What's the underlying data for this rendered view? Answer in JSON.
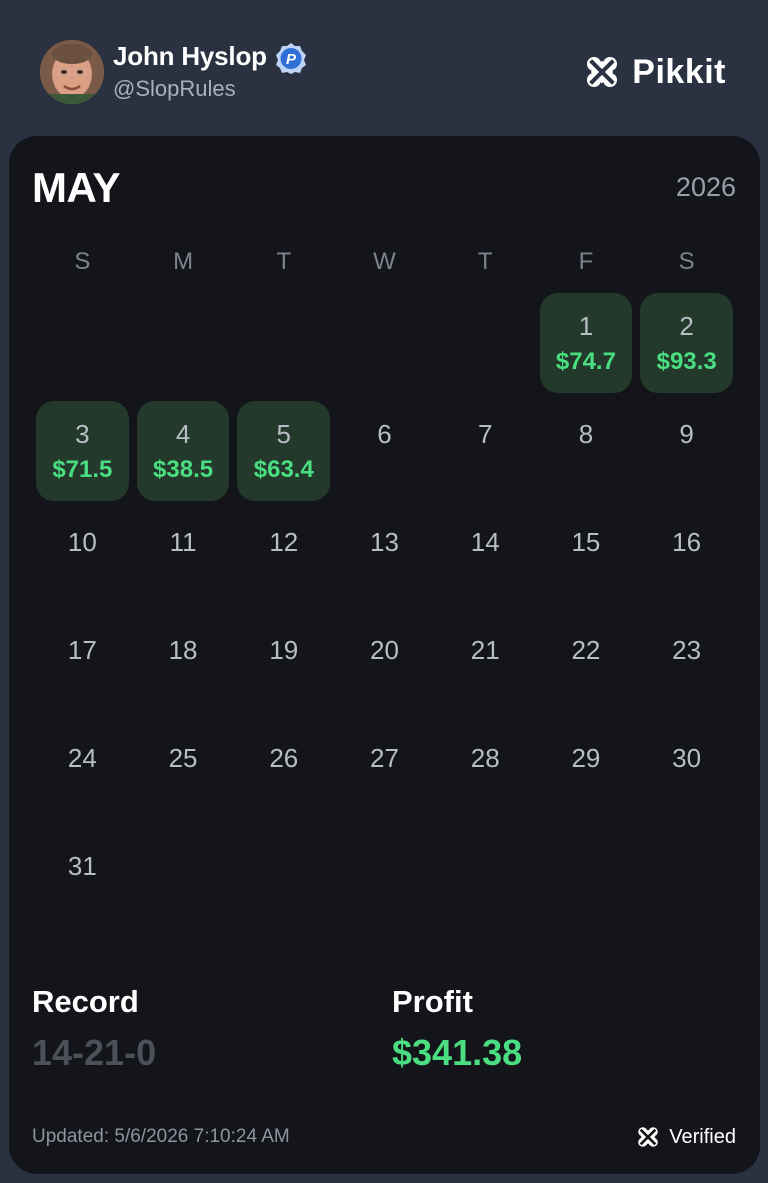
{
  "header": {
    "user_name": "John Hyslop",
    "user_handle": "@SlopRules",
    "badge_letter": "P",
    "brand_name": "Pikkit"
  },
  "calendar": {
    "month": "MAY",
    "year": "2026",
    "weekdays": [
      "S",
      "M",
      "T",
      "W",
      "T",
      "F",
      "S"
    ],
    "leading_blanks": 5,
    "days": [
      {
        "num": "1",
        "value": "$74.7"
      },
      {
        "num": "2",
        "value": "$93.3"
      },
      {
        "num": "3",
        "value": "$71.5"
      },
      {
        "num": "4",
        "value": "$38.5"
      },
      {
        "num": "5",
        "value": "$63.4"
      },
      {
        "num": "6"
      },
      {
        "num": "7"
      },
      {
        "num": "8"
      },
      {
        "num": "9"
      },
      {
        "num": "10"
      },
      {
        "num": "11"
      },
      {
        "num": "12"
      },
      {
        "num": "13"
      },
      {
        "num": "14"
      },
      {
        "num": "15"
      },
      {
        "num": "16"
      },
      {
        "num": "17"
      },
      {
        "num": "18"
      },
      {
        "num": "19"
      },
      {
        "num": "20"
      },
      {
        "num": "21"
      },
      {
        "num": "22"
      },
      {
        "num": "23"
      },
      {
        "num": "24"
      },
      {
        "num": "25"
      },
      {
        "num": "26"
      },
      {
        "num": "27"
      },
      {
        "num": "28"
      },
      {
        "num": "29"
      },
      {
        "num": "30"
      },
      {
        "num": "31"
      }
    ]
  },
  "stats": {
    "record_label": "Record",
    "record_value": "14-21-0",
    "profit_label": "Profit",
    "profit_value": "$341.38"
  },
  "footer": {
    "updated": "Updated: 5/6/2026 7:10:24 AM",
    "verified_label": "Verified"
  },
  "colors": {
    "background": "#2a3140",
    "card": "#13151a",
    "profit_cell": "#22392b",
    "profit_text": "#4ade80",
    "badge_blue": "#2f6fd6"
  },
  "icons": {
    "brand": "clover-icon",
    "badge": "verified-badge-icon",
    "verified": "clover-icon"
  }
}
